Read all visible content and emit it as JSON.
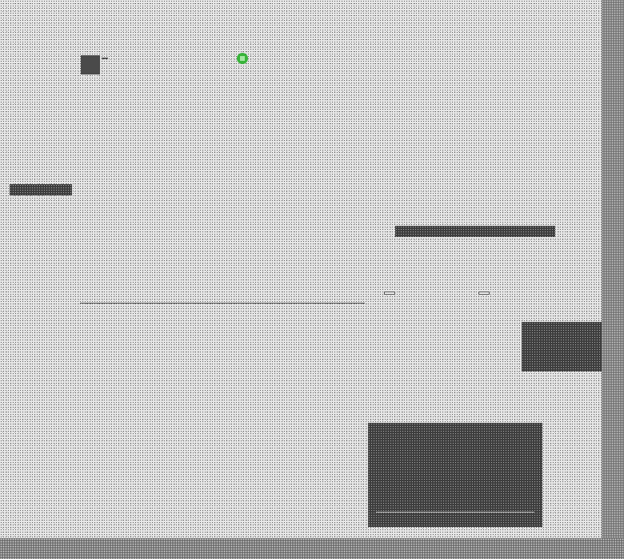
{
  "header": {
    "logo_text": "",
    "title": "",
    "subtitle": "",
    "status": ""
  },
  "sidebar": {
    "section_title": "",
    "items": [
      "",
      "",
      "",
      "",
      "",
      "",
      "",
      ""
    ],
    "selected": ""
  },
  "main": {
    "headline": "",
    "status_label": "",
    "progress_label": "",
    "links": [
      "",
      "",
      "",
      ""
    ],
    "actions": [
      "",
      ""
    ]
  },
  "footer": {
    "lines": [
      "",
      ""
    ]
  },
  "colors": {
    "accent": "#38b43a",
    "dark": "#3d3d3d"
  },
  "icons": [
    "green-badge-icon",
    "dark-thumbnail-icon"
  ]
}
